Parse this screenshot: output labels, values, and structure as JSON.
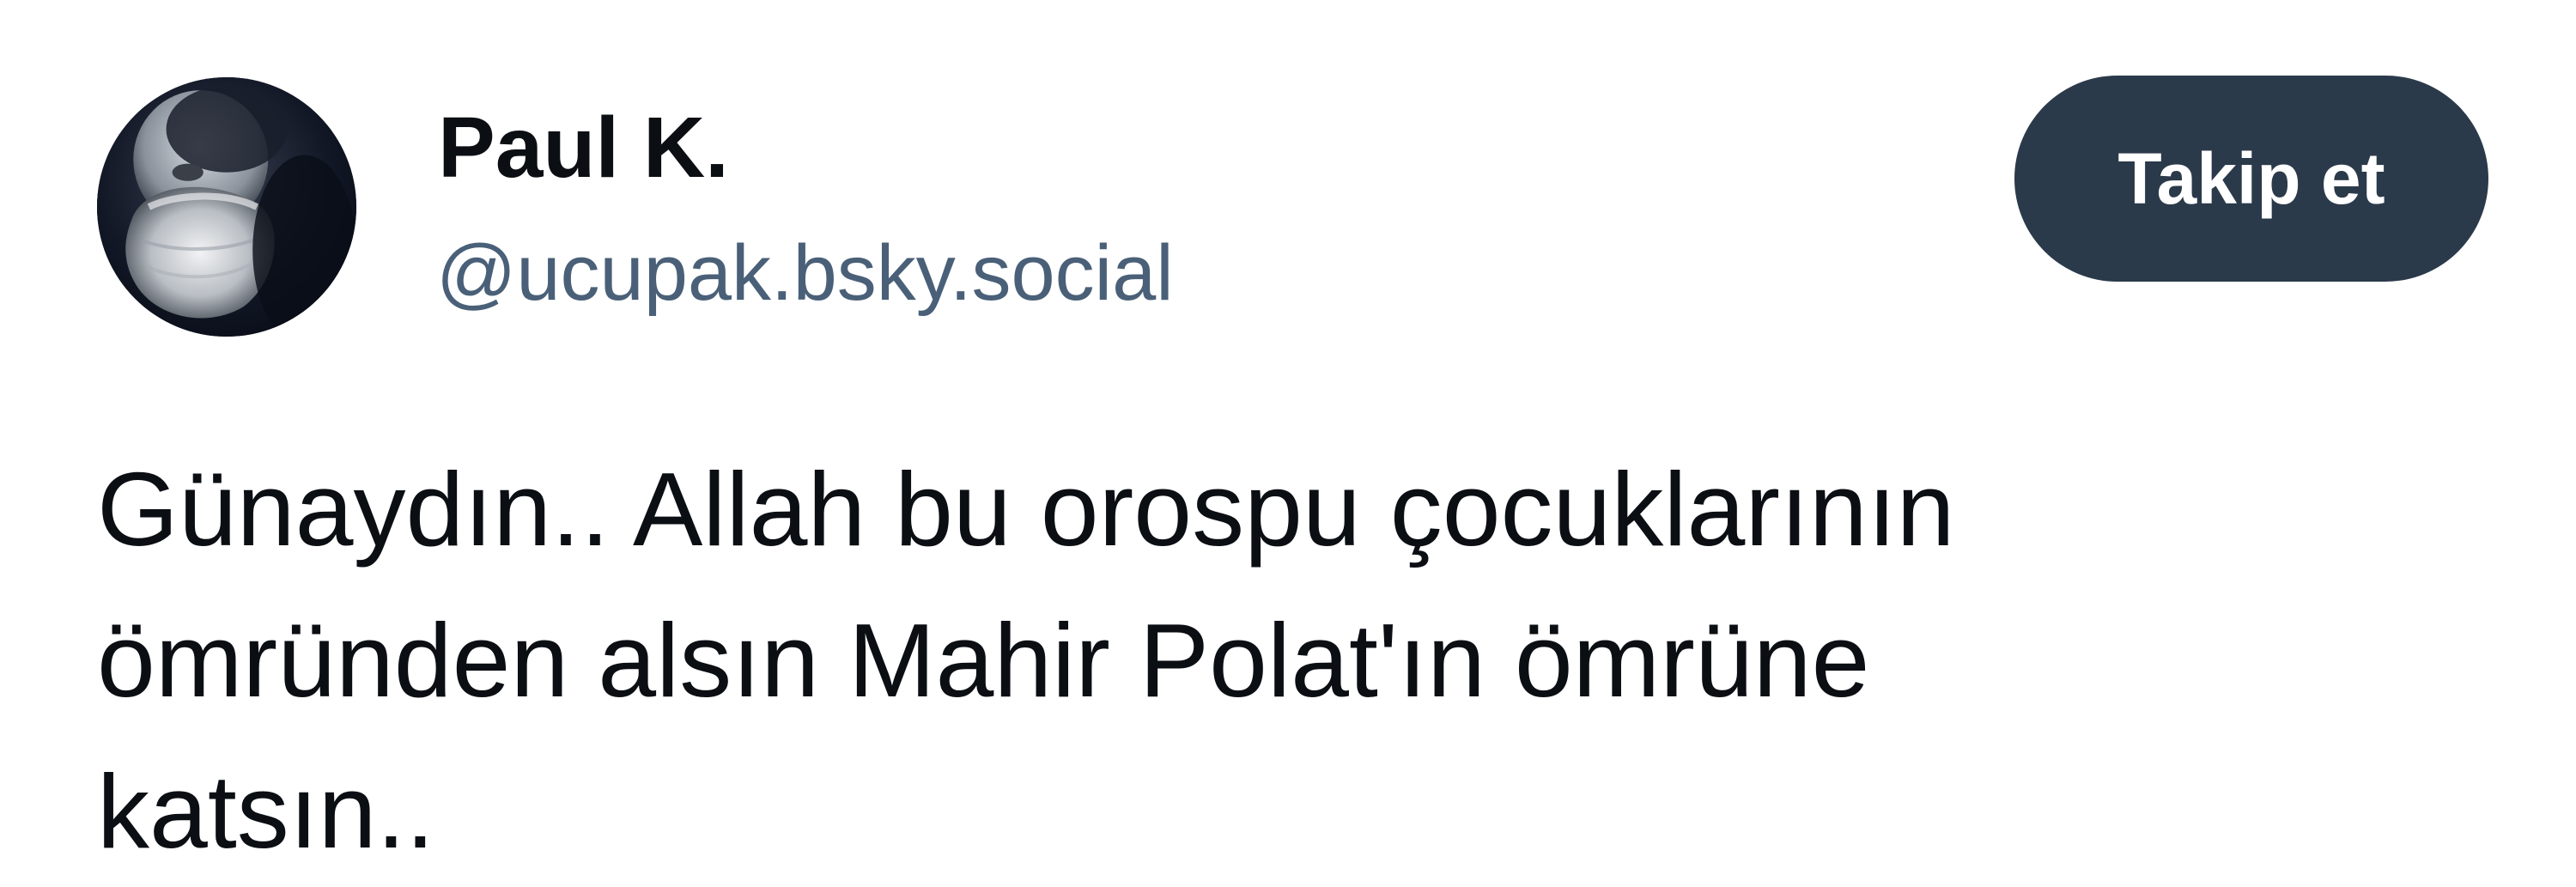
{
  "author": {
    "display_name": "Paul K.",
    "handle": "@ucupak.bsky.social",
    "avatar_icon": "bearded-man-portrait"
  },
  "actions": {
    "follow_label": "Takip et"
  },
  "post": {
    "lines": [
      "Günaydın.. Allah bu orospu çocuklarının",
      "ömründen alsın Mahir Polat'ın ömrüne",
      "katsın.."
    ]
  },
  "colors": {
    "button_background": "#2b3a4a",
    "handle_text": "#4a6078",
    "body_text": "#0b0f14"
  }
}
